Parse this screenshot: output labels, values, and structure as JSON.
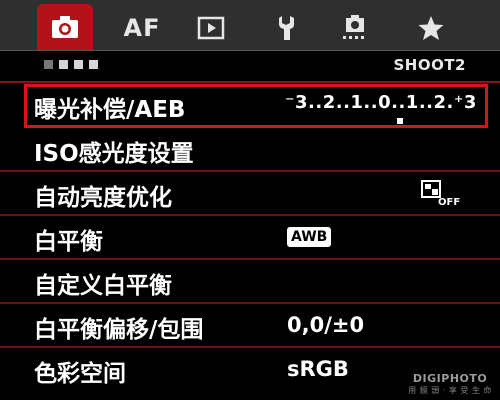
{
  "tabs": [
    {
      "id": "shoot",
      "icon": "camera-icon",
      "active": true
    },
    {
      "id": "af",
      "label": "AF",
      "active": false
    },
    {
      "id": "playback",
      "icon": "play-icon",
      "active": false
    },
    {
      "id": "setup",
      "icon": "wrench-icon",
      "active": false
    },
    {
      "id": "custom",
      "icon": "custom-functions-icon",
      "active": false
    },
    {
      "id": "mymenu",
      "icon": "star-icon",
      "active": false
    }
  ],
  "subheader": {
    "pages_total": 4,
    "page_active": 2,
    "page_label": "SHOOT2"
  },
  "menu": {
    "items": [
      {
        "label": "曝光补偿/AEB",
        "value": "⁻3..2..1..0..1..2.⁺3",
        "selected": true
      },
      {
        "label": "ISO感光度设置",
        "value": ""
      },
      {
        "label": "自动亮度优化",
        "value_icon": "auto-lighting-optimizer-off-icon"
      },
      {
        "label": "白平衡",
        "value": "AWB"
      },
      {
        "label": "自定义白平衡",
        "value": ""
      },
      {
        "label": "白平衡偏移/包围",
        "value": "0,0/±0"
      },
      {
        "label": "色彩空间",
        "value": "sRGB"
      }
    ]
  },
  "watermark": {
    "line1": "DIGIPHOTO",
    "line2": "用 鏡 頭 · 享 受 生 命"
  },
  "colors": {
    "accent": "#d6141d",
    "tab_active": "#b4121a",
    "tabbar": "#2f2f2f",
    "divider": "#6b1015"
  }
}
